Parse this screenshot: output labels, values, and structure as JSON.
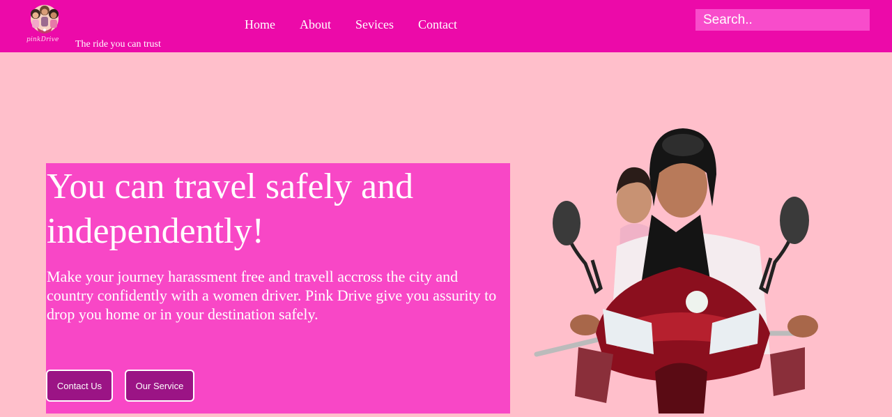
{
  "header": {
    "brand_logo_text": "pinkDrive",
    "tagline": "The ride you can trust",
    "search_placeholder": "Search..",
    "background": "#ec0aa9"
  },
  "nav": {
    "items": [
      "Home",
      "About",
      "Sevices",
      "Contact"
    ]
  },
  "hero": {
    "title": "You can travel safely and independently!",
    "description": "Make your journey harassment free and travell accross the city and country confidently with a women driver. Pink Drive give you assurity to drop you home or in your destination safely.",
    "buttons": {
      "contact": "Contact Us",
      "service": "Our Service"
    },
    "panel_color": "#f847c6",
    "page_background": "#ffbfcb",
    "button_color": "#9b1485"
  },
  "icons": {
    "logo": "women-riders-logo",
    "hero_image": "two-women-on-red-scooter"
  }
}
